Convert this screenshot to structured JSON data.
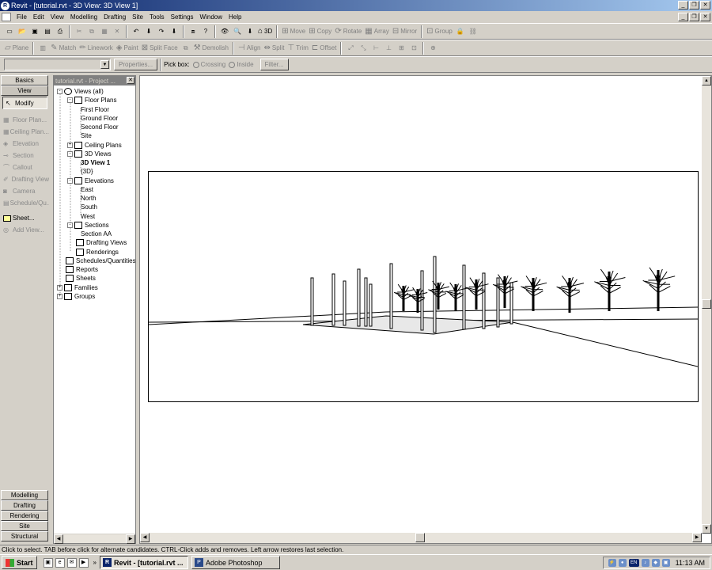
{
  "window": {
    "title": "Revit - [tutorial.rvt - 3D View: 3D View 1]"
  },
  "menu": [
    "File",
    "Edit",
    "View",
    "Modelling",
    "Drafting",
    "Site",
    "Tools",
    "Settings",
    "Window",
    "Help"
  ],
  "toolbar1": {
    "view3d_label": "3D",
    "move": "Move",
    "copy": "Copy",
    "rotate": "Rotate",
    "array": "Array",
    "mirror": "Mirror",
    "group": "Group"
  },
  "toolbar2": {
    "plane": "Plane",
    "match": "Match",
    "linework": "Linework",
    "paint": "Paint",
    "split_face": "Split Face",
    "demolish": "Demolish",
    "align": "Align",
    "split": "Split",
    "trim": "Trim",
    "offset": "Offset"
  },
  "toolbar3": {
    "properties": "Properties...",
    "pick_box": "Pick box:",
    "crossing": "Crossing",
    "inside": "Inside",
    "filter": "Filter..."
  },
  "design_bar": {
    "tabs_top": [
      "Basics",
      "View"
    ],
    "modify": "Modify",
    "tools": [
      "Floor Plan...",
      "Ceiling Plan...",
      "Elevation",
      "Section",
      "Callout",
      "Drafting View",
      "Camera",
      "Schedule/Qu..."
    ],
    "sheet": "Sheet...",
    "add_view": "Add View...",
    "tabs_bottom": [
      "Modelling",
      "Drafting",
      "Rendering",
      "Site",
      "Structural"
    ]
  },
  "project_browser": {
    "title": "tutorial.rvt - Project ...",
    "nodes": [
      {
        "label": "Views (all)",
        "level": 0,
        "pm": "-",
        "icon": "eye"
      },
      {
        "label": "Floor Plans",
        "level": 1,
        "pm": "-",
        "icon": "plan"
      },
      {
        "label": "First Floor",
        "level": 2
      },
      {
        "label": "Ground Floor",
        "level": 2
      },
      {
        "label": "Second Floor",
        "level": 2
      },
      {
        "label": "Site",
        "level": 2
      },
      {
        "label": "Ceiling Plans",
        "level": 1,
        "pm": "+",
        "icon": "plan"
      },
      {
        "label": "3D Views",
        "level": 1,
        "pm": "-",
        "icon": "cube"
      },
      {
        "label": "3D View 1",
        "level": 2,
        "bold": true
      },
      {
        "label": "{3D}",
        "level": 2
      },
      {
        "label": "Elevations",
        "level": 1,
        "pm": "-",
        "icon": "elev"
      },
      {
        "label": "East",
        "level": 2
      },
      {
        "label": "North",
        "level": 2
      },
      {
        "label": "South",
        "level": 2
      },
      {
        "label": "West",
        "level": 2
      },
      {
        "label": "Sections",
        "level": 1,
        "pm": "-",
        "icon": "elev"
      },
      {
        "label": "Section AA",
        "level": 2
      },
      {
        "label": "Drafting Views",
        "level": 1,
        "icon": "draft"
      },
      {
        "label": "Renderings",
        "level": 1,
        "icon": "draft"
      },
      {
        "label": "Schedules/Quantities",
        "level": 0,
        "icon": "sched"
      },
      {
        "label": "Reports",
        "level": 0,
        "icon": "doc"
      },
      {
        "label": "Sheets",
        "level": 0,
        "icon": "doc"
      },
      {
        "label": "Families",
        "level": 0,
        "pm": "+",
        "icon": "doc"
      },
      {
        "label": "Groups",
        "level": 0,
        "pm": "+",
        "icon": "doc"
      }
    ]
  },
  "status": "Click to select. TAB before click for alternate candidates. CTRL-Click adds and removes. Left arrow restores last selection.",
  "taskbar": {
    "start": "Start",
    "revit_task": "Revit - [tutorial.rvt ...",
    "photoshop_task": "Adobe Photoshop",
    "clock": "11:13 AM",
    "lang": "EN"
  }
}
